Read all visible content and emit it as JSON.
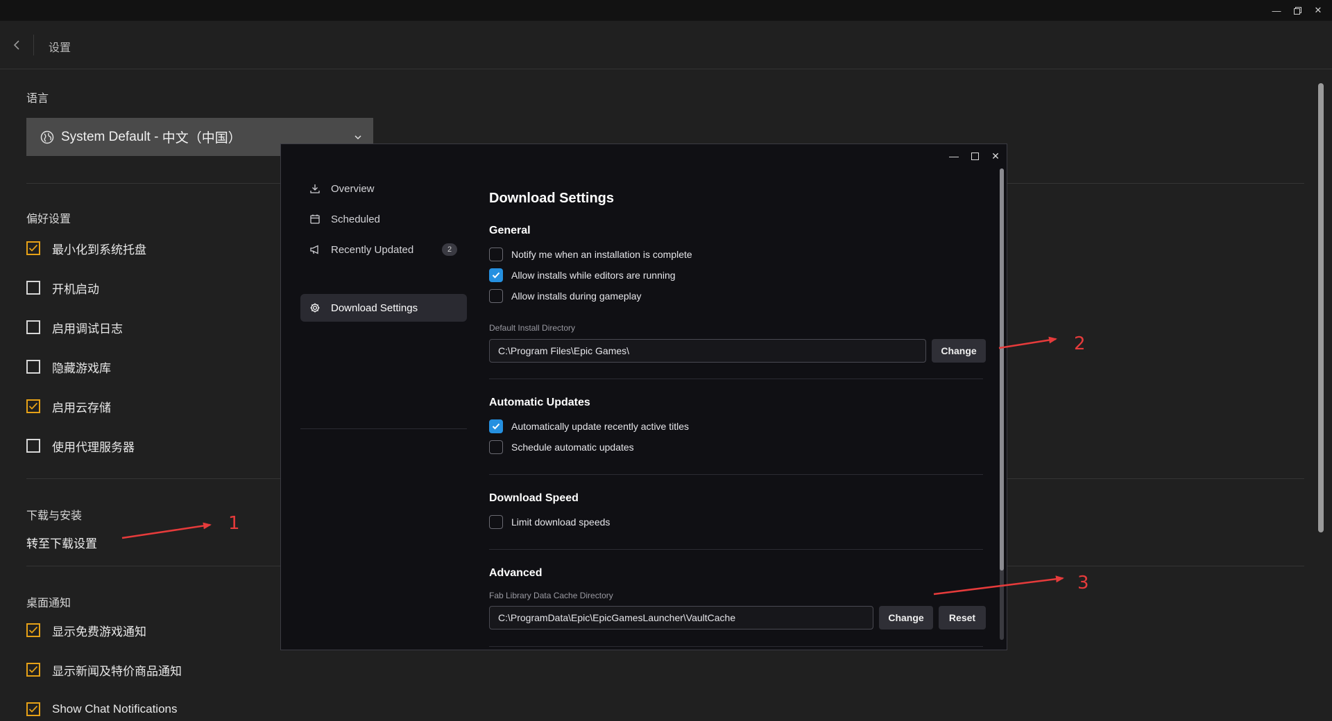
{
  "header": {
    "title": "设置"
  },
  "language": {
    "label": "语言",
    "select_prefix": "System Default - ",
    "select_value": "中文（中国）"
  },
  "preferences": {
    "label": "偏好设置",
    "items": [
      {
        "label": "最小化到系统托盘",
        "checked": true
      },
      {
        "label": "开机启动",
        "checked": false
      },
      {
        "label": "启用调试日志",
        "checked": false
      },
      {
        "label": "隐藏游戏库",
        "checked": false
      },
      {
        "label": "启用云存储",
        "checked": true
      },
      {
        "label": "使用代理服务器",
        "checked": false
      }
    ]
  },
  "downloads": {
    "label": "下载与安装",
    "link": "转至下载设置"
  },
  "desktop_notifications": {
    "label": "桌面通知",
    "items": [
      {
        "label": "显示免费游戏通知",
        "checked": true
      },
      {
        "label": "显示新闻及特价商品通知",
        "checked": true
      },
      {
        "label": "Show Chat Notifications",
        "checked": true
      }
    ]
  },
  "annotations": [
    "1",
    "2",
    "3"
  ],
  "dialog": {
    "nav": [
      {
        "label": "Overview",
        "icon": "download-icon"
      },
      {
        "label": "Scheduled",
        "icon": "calendar-icon"
      },
      {
        "label": "Recently Updated",
        "icon": "megaphone-icon",
        "badge": "2"
      },
      {
        "label": "Download Settings",
        "icon": "gear-icon",
        "active": true
      }
    ],
    "title": "Download Settings",
    "general": {
      "heading": "General",
      "options": [
        {
          "label": "Notify me when an installation is complete",
          "checked": false
        },
        {
          "label": "Allow installs while editors are running",
          "checked": true
        },
        {
          "label": "Allow installs during gameplay",
          "checked": false
        }
      ],
      "dir_label": "Default Install Directory",
      "dir_value": "C:\\Program Files\\Epic Games\\",
      "change_label": "Change"
    },
    "auto_updates": {
      "heading": "Automatic Updates",
      "options": [
        {
          "label": "Automatically update recently active titles",
          "checked": true
        },
        {
          "label": "Schedule automatic updates",
          "checked": false
        }
      ]
    },
    "speed": {
      "heading": "Download Speed",
      "options": [
        {
          "label": "Limit download speeds",
          "checked": false
        }
      ]
    },
    "advanced": {
      "heading": "Advanced",
      "cache_label": "Fab Library Data Cache Directory",
      "cache_value": "C:\\ProgramData\\Epic\\EpicGamesLauncher\\VaultCache",
      "change_label": "Change",
      "reset_label": "Reset"
    }
  },
  "colors": {
    "accent_orange": "#e6a117",
    "accent_blue": "#2590e0",
    "annotation_red": "#e63b3b"
  }
}
